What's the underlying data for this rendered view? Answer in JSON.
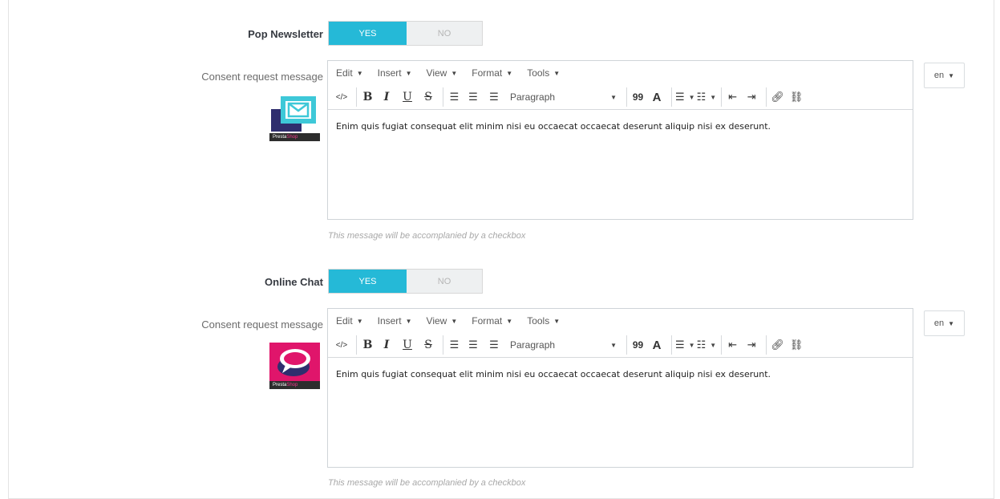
{
  "sections": [
    {
      "toggle_label": "Pop Newsletter",
      "yes": "YES",
      "no": "NO",
      "consent_label": "Consent request message",
      "menu": [
        "Edit",
        "Insert",
        "View",
        "Format",
        "Tools"
      ],
      "format_select": "Paragraph",
      "content": "Enim quis fugiat consequat elit minim nisi eu occaecat occaecat deserunt aliquip nisi ex deserunt.",
      "help": "This message will be accomplanied by a checkbox",
      "lang": "en",
      "logo_caption": "Presta",
      "logo_caption_hl": "Shop"
    },
    {
      "toggle_label": "Online Chat",
      "yes": "YES",
      "no": "NO",
      "consent_label": "Consent request message",
      "menu": [
        "Edit",
        "Insert",
        "View",
        "Format",
        "Tools"
      ],
      "format_select": "Paragraph",
      "content": "Enim quis fugiat consequat elit minim nisi eu occaecat occaecat deserunt aliquip nisi ex deserunt.",
      "help": "This message will be accomplanied by a checkbox",
      "lang": "en",
      "logo_caption": "Presta",
      "logo_caption_hl": "Shop"
    }
  ],
  "toolbar_icons": {
    "code": "</>",
    "bold": "B",
    "italic": "I",
    "underline": "U",
    "strike": "S",
    "quote": "99",
    "color": "A"
  },
  "colors": {
    "accent": "#25b9d7",
    "newsletter_logo": "#3ec8d8",
    "chat_logo": "#e0156b"
  }
}
